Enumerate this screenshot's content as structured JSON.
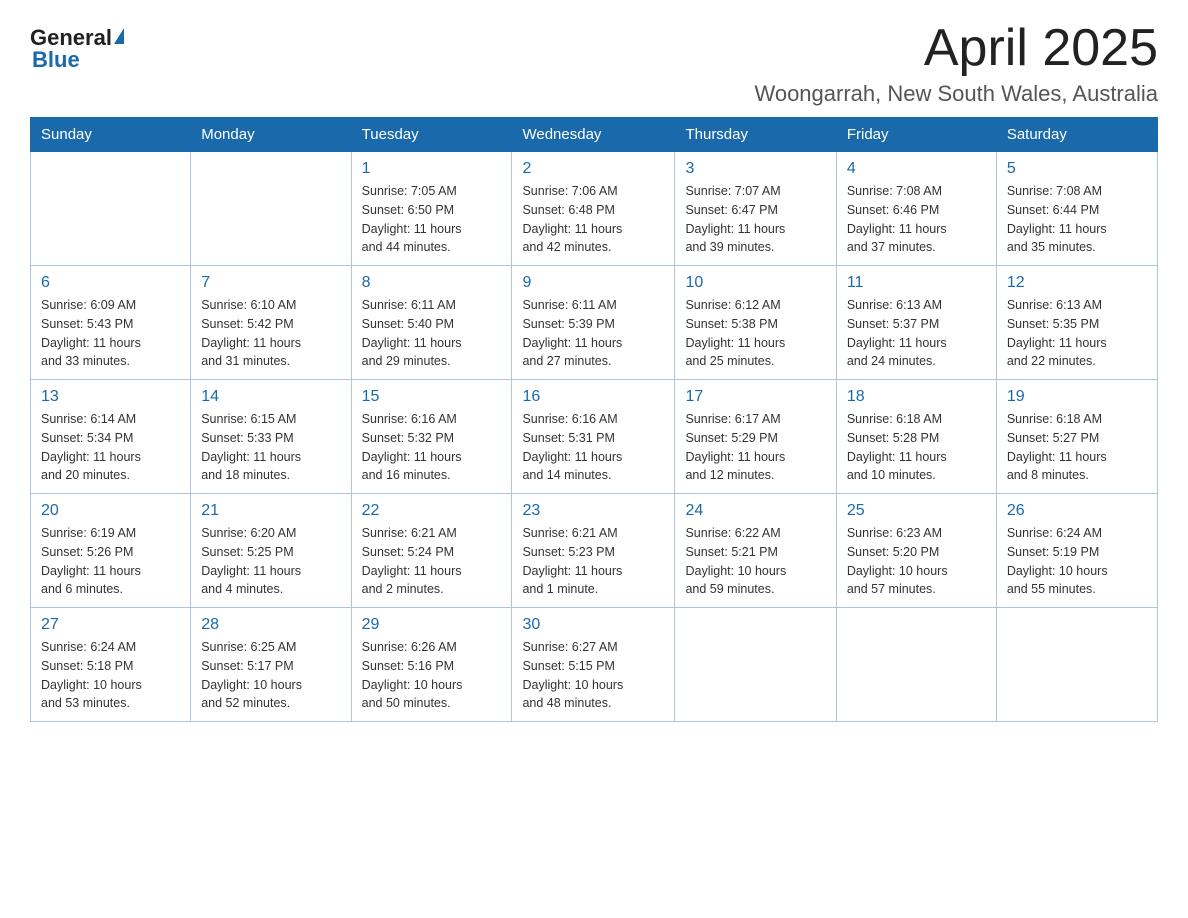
{
  "header": {
    "logo_general": "General",
    "logo_blue": "Blue",
    "month_title": "April 2025",
    "location": "Woongarrah, New South Wales, Australia"
  },
  "days_of_week": [
    "Sunday",
    "Monday",
    "Tuesday",
    "Wednesday",
    "Thursday",
    "Friday",
    "Saturday"
  ],
  "weeks": [
    [
      {
        "day": "",
        "info": ""
      },
      {
        "day": "",
        "info": ""
      },
      {
        "day": "1",
        "info": "Sunrise: 7:05 AM\nSunset: 6:50 PM\nDaylight: 11 hours\nand 44 minutes."
      },
      {
        "day": "2",
        "info": "Sunrise: 7:06 AM\nSunset: 6:48 PM\nDaylight: 11 hours\nand 42 minutes."
      },
      {
        "day": "3",
        "info": "Sunrise: 7:07 AM\nSunset: 6:47 PM\nDaylight: 11 hours\nand 39 minutes."
      },
      {
        "day": "4",
        "info": "Sunrise: 7:08 AM\nSunset: 6:46 PM\nDaylight: 11 hours\nand 37 minutes."
      },
      {
        "day": "5",
        "info": "Sunrise: 7:08 AM\nSunset: 6:44 PM\nDaylight: 11 hours\nand 35 minutes."
      }
    ],
    [
      {
        "day": "6",
        "info": "Sunrise: 6:09 AM\nSunset: 5:43 PM\nDaylight: 11 hours\nand 33 minutes."
      },
      {
        "day": "7",
        "info": "Sunrise: 6:10 AM\nSunset: 5:42 PM\nDaylight: 11 hours\nand 31 minutes."
      },
      {
        "day": "8",
        "info": "Sunrise: 6:11 AM\nSunset: 5:40 PM\nDaylight: 11 hours\nand 29 minutes."
      },
      {
        "day": "9",
        "info": "Sunrise: 6:11 AM\nSunset: 5:39 PM\nDaylight: 11 hours\nand 27 minutes."
      },
      {
        "day": "10",
        "info": "Sunrise: 6:12 AM\nSunset: 5:38 PM\nDaylight: 11 hours\nand 25 minutes."
      },
      {
        "day": "11",
        "info": "Sunrise: 6:13 AM\nSunset: 5:37 PM\nDaylight: 11 hours\nand 24 minutes."
      },
      {
        "day": "12",
        "info": "Sunrise: 6:13 AM\nSunset: 5:35 PM\nDaylight: 11 hours\nand 22 minutes."
      }
    ],
    [
      {
        "day": "13",
        "info": "Sunrise: 6:14 AM\nSunset: 5:34 PM\nDaylight: 11 hours\nand 20 minutes."
      },
      {
        "day": "14",
        "info": "Sunrise: 6:15 AM\nSunset: 5:33 PM\nDaylight: 11 hours\nand 18 minutes."
      },
      {
        "day": "15",
        "info": "Sunrise: 6:16 AM\nSunset: 5:32 PM\nDaylight: 11 hours\nand 16 minutes."
      },
      {
        "day": "16",
        "info": "Sunrise: 6:16 AM\nSunset: 5:31 PM\nDaylight: 11 hours\nand 14 minutes."
      },
      {
        "day": "17",
        "info": "Sunrise: 6:17 AM\nSunset: 5:29 PM\nDaylight: 11 hours\nand 12 minutes."
      },
      {
        "day": "18",
        "info": "Sunrise: 6:18 AM\nSunset: 5:28 PM\nDaylight: 11 hours\nand 10 minutes."
      },
      {
        "day": "19",
        "info": "Sunrise: 6:18 AM\nSunset: 5:27 PM\nDaylight: 11 hours\nand 8 minutes."
      }
    ],
    [
      {
        "day": "20",
        "info": "Sunrise: 6:19 AM\nSunset: 5:26 PM\nDaylight: 11 hours\nand 6 minutes."
      },
      {
        "day": "21",
        "info": "Sunrise: 6:20 AM\nSunset: 5:25 PM\nDaylight: 11 hours\nand 4 minutes."
      },
      {
        "day": "22",
        "info": "Sunrise: 6:21 AM\nSunset: 5:24 PM\nDaylight: 11 hours\nand 2 minutes."
      },
      {
        "day": "23",
        "info": "Sunrise: 6:21 AM\nSunset: 5:23 PM\nDaylight: 11 hours\nand 1 minute."
      },
      {
        "day": "24",
        "info": "Sunrise: 6:22 AM\nSunset: 5:21 PM\nDaylight: 10 hours\nand 59 minutes."
      },
      {
        "day": "25",
        "info": "Sunrise: 6:23 AM\nSunset: 5:20 PM\nDaylight: 10 hours\nand 57 minutes."
      },
      {
        "day": "26",
        "info": "Sunrise: 6:24 AM\nSunset: 5:19 PM\nDaylight: 10 hours\nand 55 minutes."
      }
    ],
    [
      {
        "day": "27",
        "info": "Sunrise: 6:24 AM\nSunset: 5:18 PM\nDaylight: 10 hours\nand 53 minutes."
      },
      {
        "day": "28",
        "info": "Sunrise: 6:25 AM\nSunset: 5:17 PM\nDaylight: 10 hours\nand 52 minutes."
      },
      {
        "day": "29",
        "info": "Sunrise: 6:26 AM\nSunset: 5:16 PM\nDaylight: 10 hours\nand 50 minutes."
      },
      {
        "day": "30",
        "info": "Sunrise: 6:27 AM\nSunset: 5:15 PM\nDaylight: 10 hours\nand 48 minutes."
      },
      {
        "day": "",
        "info": ""
      },
      {
        "day": "",
        "info": ""
      },
      {
        "day": "",
        "info": ""
      }
    ]
  ]
}
